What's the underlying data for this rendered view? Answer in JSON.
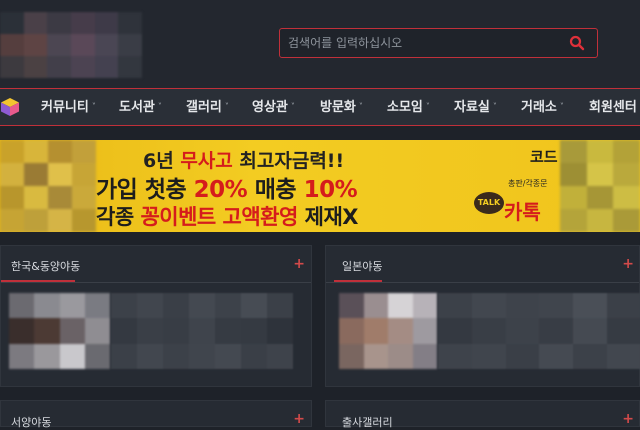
{
  "search": {
    "placeholder": "검색어를 입력하십시오"
  },
  "nav": {
    "items": [
      {
        "label": "커뮤니티",
        "chevron": "˅"
      },
      {
        "label": "도서관",
        "chevron": "˅"
      },
      {
        "label": "갤러리",
        "chevron": "˅"
      },
      {
        "label": "영상관",
        "chevron": "˅"
      },
      {
        "label": "방문화",
        "chevron": "˅"
      },
      {
        "label": "소모임",
        "chevron": "˅"
      },
      {
        "label": "자료실",
        "chevron": "˅"
      },
      {
        "label": "거래소",
        "chevron": "˅"
      },
      {
        "label": "회원센터",
        "chevron": "˅"
      }
    ]
  },
  "banner": {
    "line1_pre": "6년 ",
    "line1_red": "무사고",
    "line1_post": " 최고자금력!!",
    "line2_pre": "가입 첫충 ",
    "line2_red1": "20%",
    "line2_mid": " 매충 ",
    "line2_red2": "10%",
    "line3_pre": "각종 ",
    "line3_red1": "꽁이벤트",
    "line3_mid": " ",
    "line3_red2": "고액환영",
    "line3_post": " 제재X",
    "talk": "TALK",
    "code": "코드",
    "small": "총판/각종문",
    "kakao": "카톡"
  },
  "panels": [
    {
      "title": "한국&동양야동",
      "plus": "+"
    },
    {
      "title": "일본야동",
      "plus": "+"
    },
    {
      "title": "서양야동",
      "plus": "+"
    },
    {
      "title": "출사갤러리",
      "plus": "+"
    }
  ],
  "colors": {
    "accent": "#c0303a",
    "banner_yellow": "#f3cc22",
    "banner_red": "#d51c1c"
  },
  "icons": {
    "search": "search-icon",
    "logo": "cube-logo-icon"
  }
}
